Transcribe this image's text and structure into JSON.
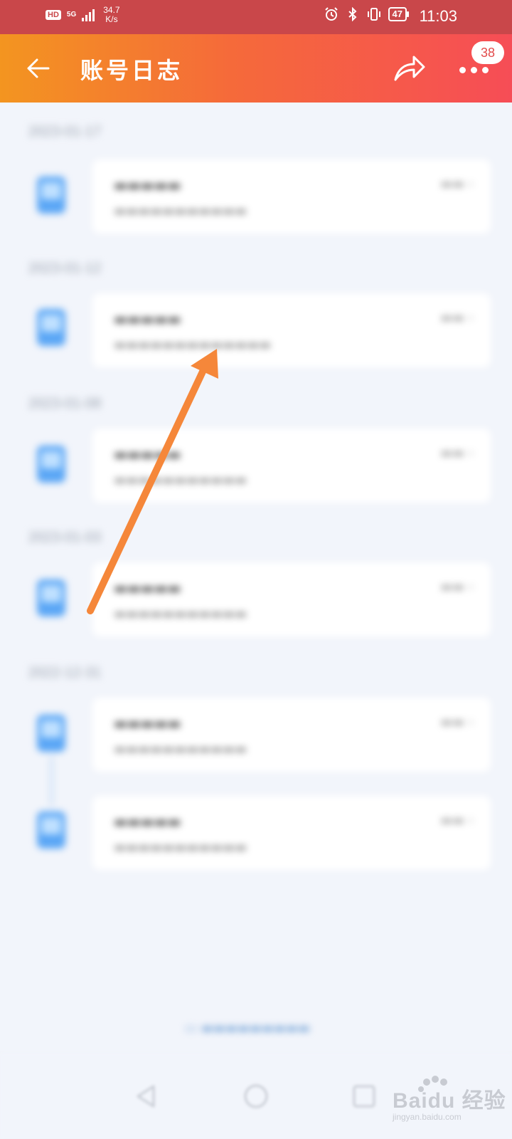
{
  "status_bar": {
    "hd": "HD",
    "network": "5G",
    "net_speed_value": "34.7",
    "net_speed_unit": "K/s",
    "battery": "47",
    "time": "11:03"
  },
  "header": {
    "title": "账号日志",
    "badge_count": "38"
  },
  "log_groups": [
    {
      "date": "2023-01-17"
    },
    {
      "date": "2023-01-12"
    },
    {
      "date": "2023-01-08"
    },
    {
      "date": "2023-01-03"
    },
    {
      "date": "2022-12-31"
    }
  ],
  "watermark": {
    "text": "Baidu 经验",
    "sub": "jingyan.baidu.com"
  },
  "colors": {
    "status_bar": "#c9474a",
    "header_start": "#f39520",
    "header_end": "#f64d56",
    "annotation_arrow": "#f5873a"
  }
}
